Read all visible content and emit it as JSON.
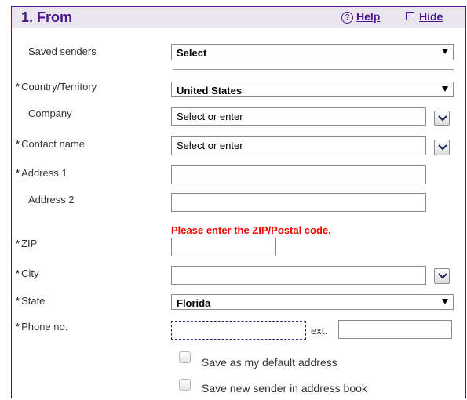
{
  "header": {
    "title": "1. From",
    "help_label": "Help",
    "help_icon": "help-circle-icon",
    "hide_label": "Hide",
    "hide_icon": "collapse-box-icon"
  },
  "form": {
    "saved_senders": {
      "label": "Saved senders",
      "value": "Select"
    },
    "country": {
      "label": "Country/Territory",
      "value": "United States",
      "required": true
    },
    "company": {
      "label": "Company",
      "value": "Select or enter"
    },
    "contact_name": {
      "label": "Contact name",
      "value": "Select or enter",
      "required": true
    },
    "address1": {
      "label": "Address 1",
      "value": "",
      "required": true
    },
    "address2": {
      "label": "Address 2",
      "value": ""
    },
    "zip_error": "Please enter the ZIP/Postal code.",
    "zip": {
      "label": "ZIP",
      "value": "",
      "required": true
    },
    "city": {
      "label": "City",
      "value": "",
      "required": true
    },
    "state": {
      "label": "State",
      "value": "Florida",
      "required": true
    },
    "phone": {
      "label": "Phone no.",
      "value": "",
      "required": true,
      "ext_label": "ext.",
      "ext_value": ""
    },
    "required_marker": "*",
    "checkbox_default": {
      "label": "Save as my default address",
      "checked": false
    },
    "checkbox_addressbook": {
      "label": "Save new sender in address book",
      "checked": false
    }
  },
  "colors": {
    "accent": "#4d148c",
    "header_bg": "#eae6ef",
    "error": "#ff0000"
  }
}
